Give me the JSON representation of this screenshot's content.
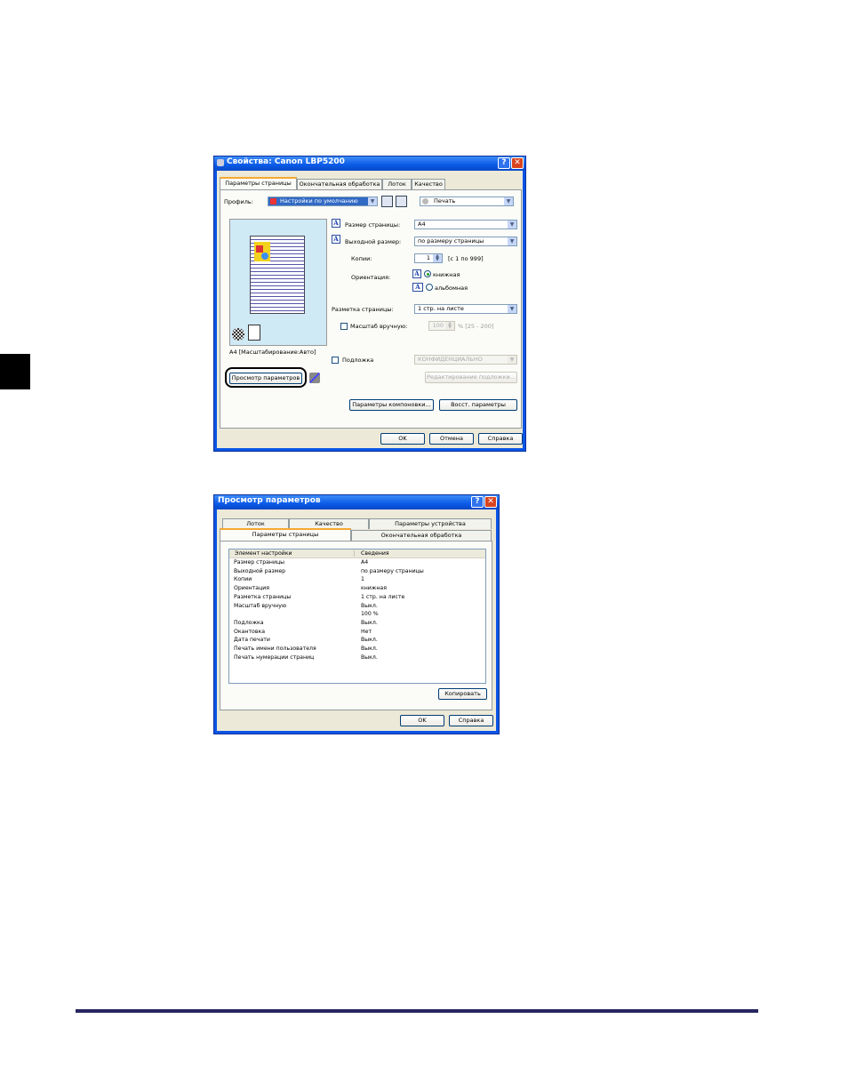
{
  "dialog1": {
    "title": "Свойства: Canon LBP5200",
    "tabs": [
      "Параметры страницы",
      "Окончательная обработка",
      "Лоток",
      "Качество"
    ],
    "profile_label": "Профиль:",
    "profile_value": "Настройки по умолчанию",
    "output_method": "Печать",
    "preview_caption": "A4 [Масштабирование:Авто]",
    "page_size_label": "Размер страницы:",
    "page_size_value": "A4",
    "output_size_label": "Выходной размер:",
    "output_size_value": "по размеру страницы",
    "copies_label": "Копии:",
    "copies_value": "1",
    "copies_range": "[с 1 по 999]",
    "orientation_label": "Ориентация:",
    "portrait": "книжная",
    "landscape": "альбомная",
    "page_layout_label": "Разметка страницы:",
    "page_layout_value": "1 стр. на листе",
    "manual_scale_label": "Масштаб вручную:",
    "manual_scale_value": "100",
    "manual_scale_range": "% [25 - 200]",
    "watermark_label": "Подложка",
    "watermark_value": "КОНФИДЕНЦИАЛЬНО",
    "edit_watermark_button": "Редактирование подложки...",
    "view_settings_button": "Просмотр параметров",
    "layout_params_button": "Параметры компоновки...",
    "restore_defaults_button": "Восст. параметры",
    "ok_button": "OK",
    "cancel_button": "Отмена",
    "help_button": "Справка"
  },
  "dialog2": {
    "title": "Просмотр параметров",
    "tabs_back": [
      "Лоток",
      "Качество",
      "Параметры устройства"
    ],
    "tabs_front": [
      "Параметры страницы",
      "Окончательная обработка"
    ],
    "col_headers": [
      "Элемент настройки",
      "Сведения"
    ],
    "rows": [
      [
        "Размер страницы",
        "A4"
      ],
      [
        "Выходной размер",
        "по размеру страницы"
      ],
      [
        "Копии",
        "1"
      ],
      [
        "Ориентация",
        "книжная"
      ],
      [
        "Разметка страницы",
        "1 стр. на листе"
      ],
      [
        "Масштаб вручную",
        "Выкл."
      ],
      [
        "",
        "100 %"
      ],
      [
        "Подложка",
        "Выкл."
      ],
      [
        "Окантовка",
        "Нет"
      ],
      [
        "Дата печати",
        "Выкл."
      ],
      [
        "Печать имени пользователя",
        "Выкл."
      ],
      [
        "Печать нумерации страниц",
        "Выкл."
      ]
    ],
    "copy_button": "Копировать",
    "ok_button": "OK",
    "help_button": "Справка"
  },
  "colors": {
    "title_blue": "#0a5ae8",
    "face": "#ece9d8",
    "rule": "#27265f"
  }
}
